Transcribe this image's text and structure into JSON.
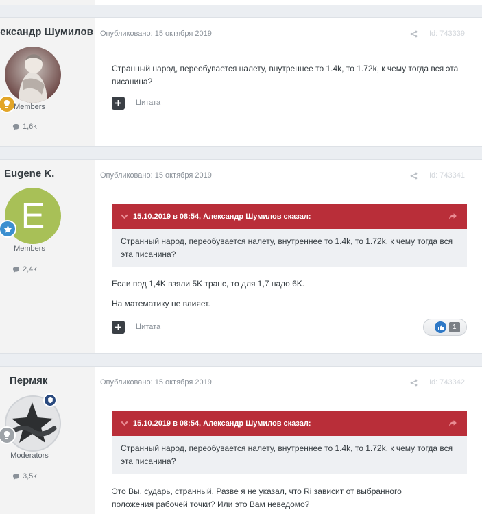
{
  "posts": [
    {
      "author": "Александр Шумилов",
      "group": "Members",
      "count": "1,6k",
      "meta": "Опубликовано: 15 октября 2019",
      "post_id": "Id: 743339",
      "content": [
        "Странный народ, переобувается налету, внутреннее то 1.4k, то 1.72k, к чему тогда вся эта писанина?"
      ],
      "quote_label": "Цитата"
    },
    {
      "author": "Eugene K.",
      "avatar_letter": "E",
      "avatar_color": "#a8c057",
      "group": "Members",
      "count": "2,4k",
      "meta": "Опубликовано: 15 октября 2019",
      "post_id": "Id: 743341",
      "quote_header": "15.10.2019 в 08:54, Александр Шумилов сказал:",
      "quote_text": "Странный народ, переобувается налету, внутреннее то 1.4k, то 1.72k, к чему тогда вся эта писанина?",
      "content": [
        "Если под 1,4K взяли 5K транс, то для 1,7 надо 6K.",
        "На математику не влияет."
      ],
      "quote_label": "Цитата",
      "reaction_count": "1"
    },
    {
      "author": "Пермяк",
      "group": "Moderators",
      "count": "3,5k",
      "meta": "Опубликовано: 15 октября 2019",
      "post_id": "Id: 743342",
      "quote_header": "15.10.2019 в 08:54, Александр Шумилов сказал:",
      "quote_text": "Странный народ, переобувается налету, внутреннее то 1.4k, то 1.72k, к чему тогда вся эта писанина?",
      "content": [
        "Это Вы, сударь, странный. Разве я не указал, что Ri зависит от выбранного положения рабочей точки? Или это Вам неведомо?"
      ]
    }
  ],
  "colors": {
    "quote_header": "#b92e39",
    "sidebar": "#f3f3f3",
    "accent_blue": "#2f79c6",
    "rank_gold": "#e2a528"
  },
  "icons": [
    "comment-icon",
    "share-icon",
    "chevron-down-icon",
    "share-arrow-icon",
    "multiquote-plus-icon",
    "thumbs-up-icon",
    "rank-star-icon",
    "rank-bulb-icon",
    "moderator-shield-icon"
  ]
}
